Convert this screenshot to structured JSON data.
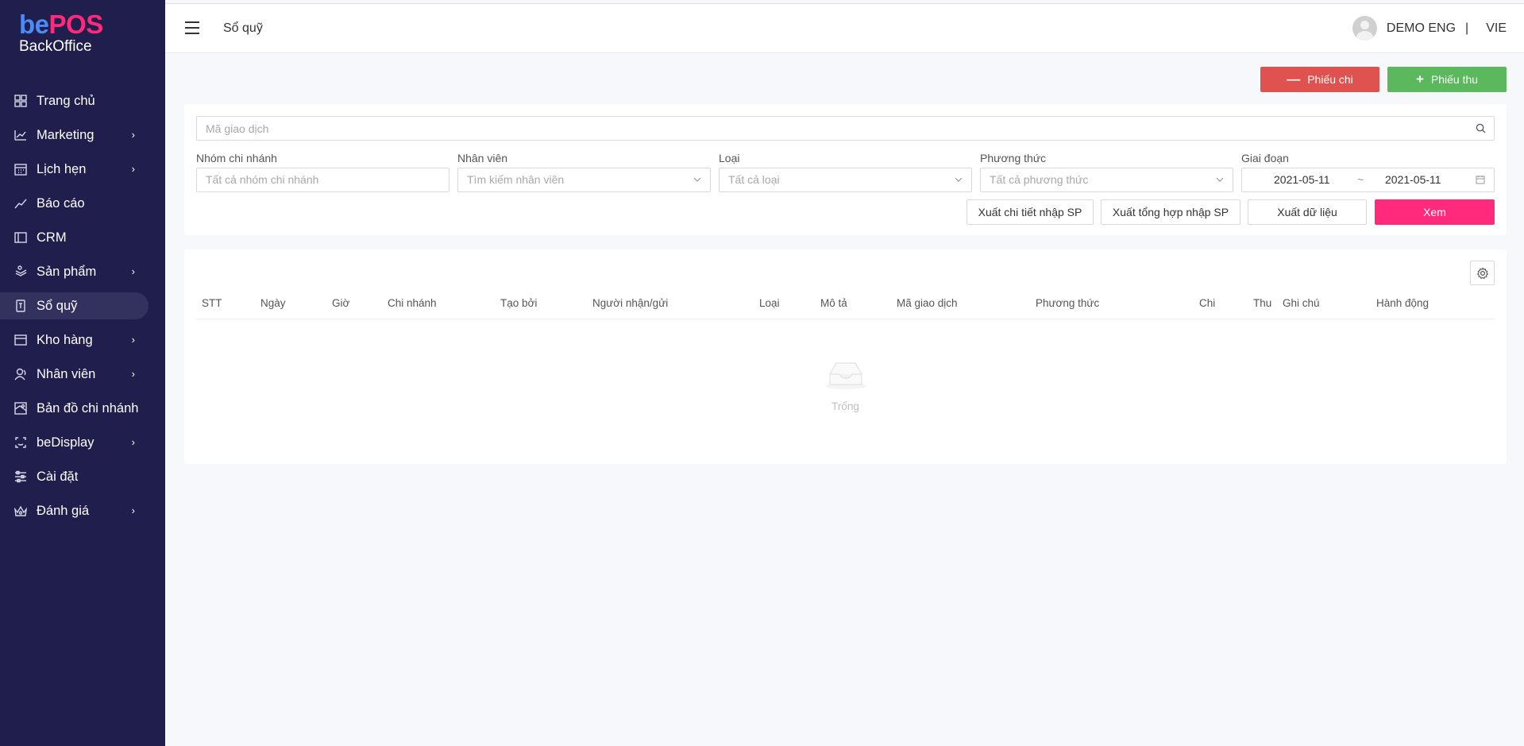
{
  "brand": {
    "be": "be",
    "pos": "POS",
    "sub": "BackOffice"
  },
  "sidebar": {
    "items": [
      {
        "label": "Trang chủ",
        "icon": "grid-icon",
        "chevron": false,
        "active": false
      },
      {
        "label": "Marketing",
        "icon": "chart-line-icon",
        "chevron": true,
        "active": false
      },
      {
        "label": "Lịch hẹn",
        "icon": "calendar-icon",
        "chevron": true,
        "active": false
      },
      {
        "label": "Báo cáo",
        "icon": "trend-icon",
        "chevron": false,
        "active": false
      },
      {
        "label": "CRM",
        "icon": "crm-icon",
        "chevron": false,
        "active": false
      },
      {
        "label": "Sản phẩm",
        "icon": "product-icon",
        "chevron": true,
        "active": false
      },
      {
        "label": "Sổ quỹ",
        "icon": "cashbook-icon",
        "chevron": false,
        "active": true
      },
      {
        "label": "Kho hàng",
        "icon": "warehouse-icon",
        "chevron": true,
        "active": false
      },
      {
        "label": "Nhân viên",
        "icon": "staff-icon",
        "chevron": true,
        "active": false
      },
      {
        "label": "Bản đồ chi nhánh",
        "icon": "map-icon",
        "chevron": false,
        "active": false
      },
      {
        "label": "beDisplay",
        "icon": "display-icon",
        "chevron": true,
        "active": false
      },
      {
        "label": "Cài đặt",
        "icon": "settings-sliders-icon",
        "chevron": false,
        "active": false
      },
      {
        "label": "Đánh giá",
        "icon": "rating-icon",
        "chevron": true,
        "active": false
      }
    ],
    "chevron_glyph": "›"
  },
  "header": {
    "title": "Sổ quỹ",
    "user": "DEMO ENG",
    "separator": "|",
    "language": "VIE"
  },
  "actions": {
    "expense_label": "Phiếu chi",
    "expense_symbol": "—",
    "income_label": "Phiếu thu",
    "income_symbol": "+"
  },
  "filters": {
    "search_placeholder": "Mã giao dịch",
    "branch_group": {
      "label": "Nhóm chi nhánh",
      "placeholder": "Tất cả nhóm chi nhánh"
    },
    "staff": {
      "label": "Nhân viên",
      "placeholder": "Tìm kiếm nhân viên"
    },
    "type": {
      "label": "Loại",
      "placeholder": "Tất cả loại"
    },
    "method": {
      "label": "Phương thức",
      "placeholder": "Tất cả phương thức"
    },
    "period": {
      "label": "Giai đoạn",
      "from": "2021-05-11",
      "sep": "~",
      "to": "2021-05-11"
    },
    "export_detail": "Xuất chi tiết nhập SP",
    "export_summary": "Xuất tổng hợp nhập SP",
    "export_data": "Xuất dữ liệu",
    "view": "Xem"
  },
  "table": {
    "columns": [
      "STT",
      "Ngày",
      "Giờ",
      "Chi nhánh",
      "Tạo bởi",
      "Người nhận/gửi",
      "Loại",
      "Mô tả",
      "Mã giao dịch",
      "Phương thức",
      "Chi",
      "Thu",
      "Ghi chú",
      "Hành động"
    ],
    "empty_text": "Trống"
  },
  "colors": {
    "sidebar_bg": "#201e4d",
    "brand_blue": "#4a8bf5",
    "brand_pink": "#ff2a7c",
    "expense_red": "#e0524f",
    "income_green": "#5cb85c"
  }
}
